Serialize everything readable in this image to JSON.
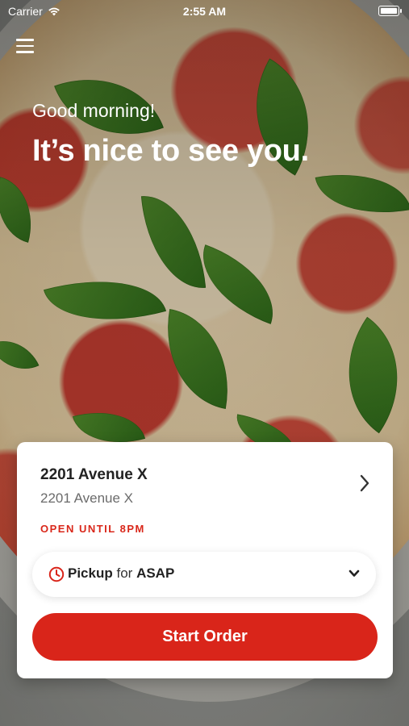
{
  "status_bar": {
    "carrier": "Carrier",
    "time": "2:55 AM"
  },
  "header": {
    "menu_icon": "hamburger-menu-icon"
  },
  "hero": {
    "greeting": "Good morning!",
    "headline": "It’s nice to see you."
  },
  "location": {
    "name": "2201 Avenue X",
    "address": "2201 Avenue X",
    "hours": "OPEN UNTIL 8PM",
    "chevron_icon": "chevron-right-icon"
  },
  "order_mode": {
    "mode": "Pickup",
    "connector": "for",
    "time": "ASAP",
    "icon": "clock-icon",
    "dropdown_icon": "chevron-down-icon"
  },
  "cta": {
    "label": "Start Order"
  },
  "colors": {
    "accent": "#d9251a",
    "hours_text": "#d9271a"
  }
}
